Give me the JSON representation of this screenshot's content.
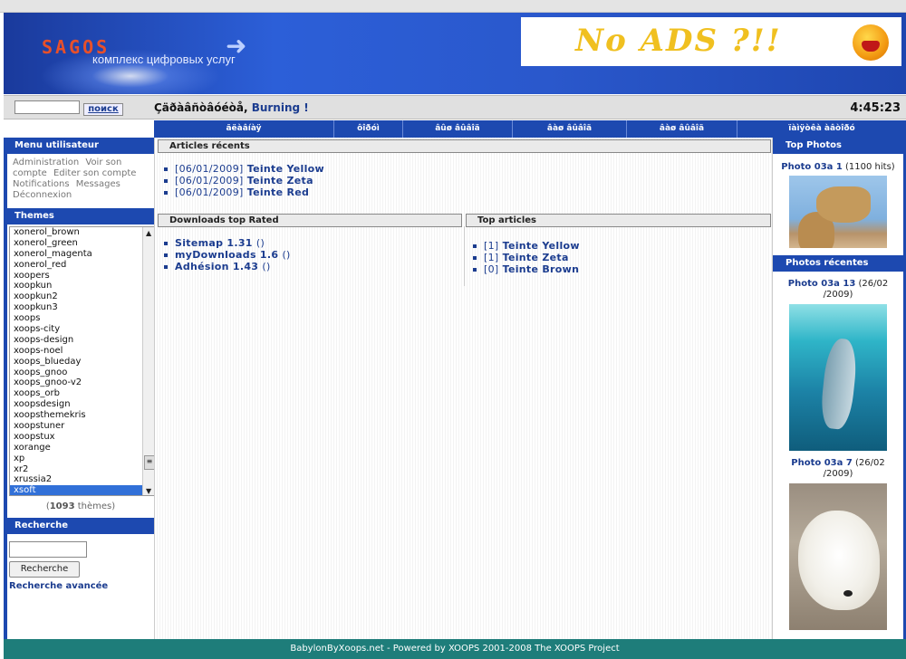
{
  "header": {
    "logo_text": "SAGOS",
    "tagline": "комплекс цифровых услуг",
    "ad_text": "No ADS ?!!"
  },
  "searchbar": {
    "button_label": "поиск",
    "greeting_prefix": "Çäðàâñòâóéòå,",
    "username": "Burning !",
    "clock": "4:45:23"
  },
  "navbar": {
    "items": [
      {
        "label": "ãëàâíàÿ"
      },
      {
        "label": "ôîðóì"
      },
      {
        "label": "âûø âûâîä"
      },
      {
        "label": "âàø âûâîä"
      },
      {
        "label": "âàø âûâîä"
      },
      {
        "label": "ïàìÿòêà àâòîðó"
      }
    ]
  },
  "left": {
    "user_menu_title": "Menu utilisateur",
    "user_menu_items": [
      "Administration",
      "Voir son compte",
      "Editer son compte",
      "Notifications",
      "Messages",
      "Déconnexion"
    ],
    "themes_title": "Themes",
    "themes": [
      "xonerol_brown",
      "xonerol_green",
      "xonerol_magenta",
      "xonerol_red",
      "xoopers",
      "xoopkun",
      "xoopkun2",
      "xoopkun3",
      "xoops",
      "xoops-city",
      "xoops-design",
      "xoops-noel",
      "xoops_blueday",
      "xoops_gnoo",
      "xoops_gnoo-v2",
      "xoops_orb",
      "xoopsdesign",
      "xoopsthemekris",
      "xoopstuner",
      "xoopstux",
      "xorange",
      "xp",
      "xr2",
      "xrussia2",
      "xsoft"
    ],
    "selected_theme": "xsoft",
    "theme_count": "1093",
    "theme_count_suffix": "thèmes",
    "search_title": "Recherche",
    "search_button": "Recherche",
    "advanced_search": "Recherche avancée"
  },
  "center": {
    "recent_articles_title": "Articles récents",
    "recent_articles": [
      {
        "date": "[06/01/2009]",
        "title": "Teinte Yellow"
      },
      {
        "date": "[06/01/2009]",
        "title": "Teinte Zeta"
      },
      {
        "date": "[06/01/2009]",
        "title": "Teinte Red"
      }
    ],
    "downloads_title": "Downloads top Rated",
    "downloads": [
      {
        "title": "Sitemap 1.31",
        "count": "()"
      },
      {
        "title": "myDownloads 1.6",
        "count": "()"
      },
      {
        "title": "Adhésion 1.43",
        "count": "()"
      }
    ],
    "top_articles_title": "Top articles",
    "top_articles": [
      {
        "count": "[1]",
        "title": "Teinte Yellow"
      },
      {
        "count": "[1]",
        "title": "Teinte Zeta"
      },
      {
        "count": "[0]",
        "title": "Teinte Brown"
      }
    ]
  },
  "right": {
    "top_photos_title": "Top Photos",
    "top_photo": {
      "name": "Photo 03a 1",
      "hits": "(1100 hits)"
    },
    "recent_photos_title": "Photos récentes",
    "recent_photos": [
      {
        "name": "Photo 03a 13",
        "date_a": "(26/02",
        "date_b": "/2009)"
      },
      {
        "name": "Photo 03a 7",
        "date_a": "(26/02",
        "date_b": "/2009)"
      }
    ]
  },
  "footer": {
    "text": "BabylonByXoops.net - Powered by XOOPS 2001-2008 The XOOPS Project"
  }
}
